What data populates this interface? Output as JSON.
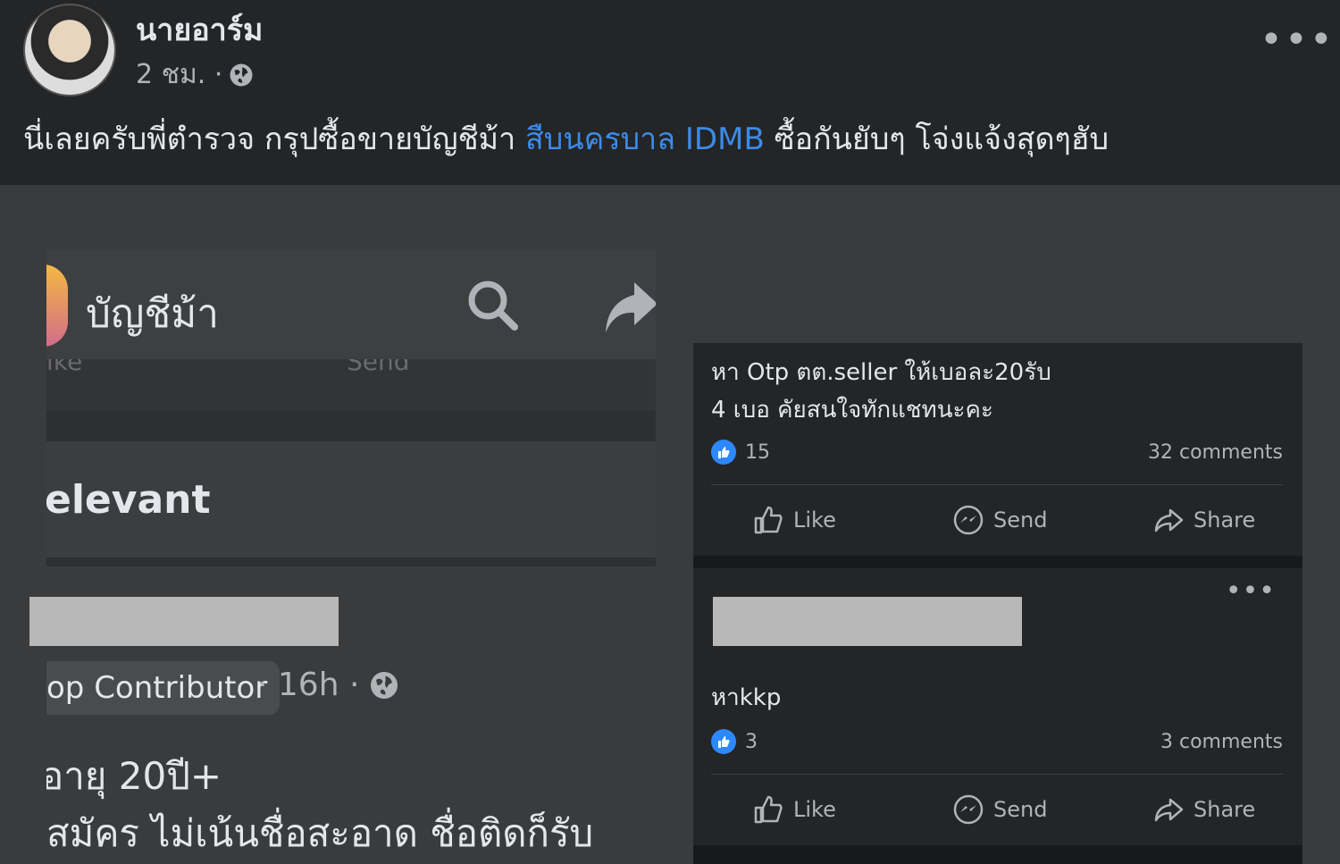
{
  "post": {
    "author": "นายอาร์ม",
    "time": "2 ชม. ·",
    "text_before": "นี่เลยครับพี่ตำรวจ กรุปซื้อขายบัญชีม้า ",
    "text_link": "สืบนครบาล IDMB",
    "text_after": "  ซื้อกันยับๆ โจ่งแจ้งสุดๆฮับ",
    "more": "•••"
  },
  "left_screenshot": {
    "group_title": "บัญชีม้า",
    "ghost_like": "ike",
    "ghost_send": "Send",
    "section_heading": "elevant",
    "badge": "op Contributor",
    "time": "· 16h ·",
    "line1": "อายุ 20ปี+",
    "line2": "สมัคร  ไม่เน้นชื่อสะอาด ชื่อติดก็รับ"
  },
  "right_screenshot": {
    "post1": {
      "text_line1": "หา Otp ตต.seller ให้เบอละ20รับ",
      "text_line2": "4 เบอ คัยสนใจทักแชทนะคะ",
      "reactions": "15",
      "comments": "32 comments"
    },
    "post2": {
      "text": "หาkkp",
      "reactions": "3",
      "comments": "3 comments",
      "more": "•••"
    },
    "actions": {
      "like": "Like",
      "send": "Send",
      "share": "Share"
    }
  },
  "colors": {
    "link": "#3b8be8",
    "like_blue": "#2d88ff",
    "background": "#3a3b3c",
    "card": "#242526"
  }
}
